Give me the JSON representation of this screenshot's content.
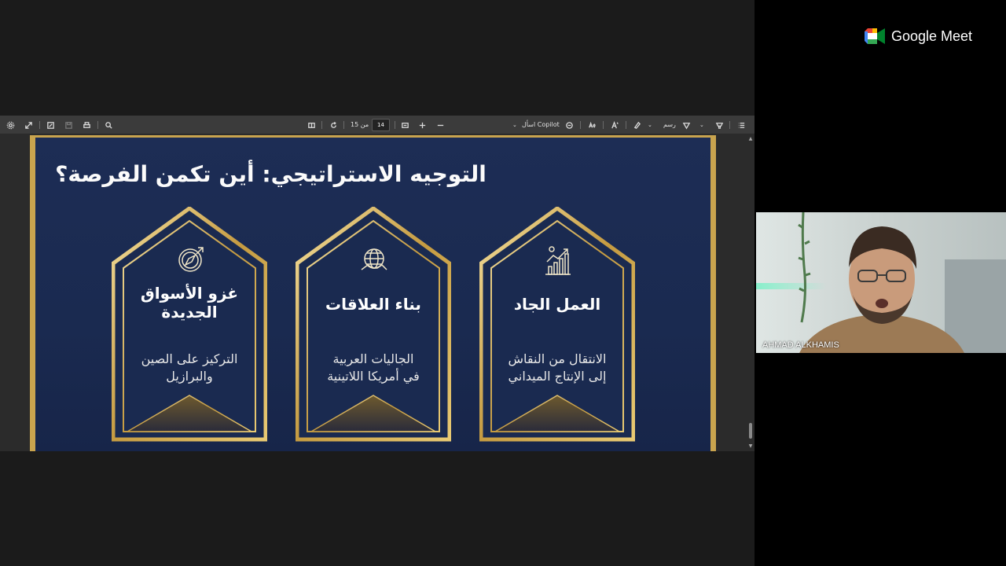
{
  "toolbar": {
    "page_current": "14",
    "page_total_label": "من 15",
    "ask_copilot": "اسأل Copilot",
    "draw_label": "رسم"
  },
  "slide": {
    "title": "التوجيه الاستراتيجي: أين تكمن الفرصة؟",
    "cards": [
      {
        "title": "العمل الجاد",
        "desc_line1": "الانتقال من النقاش",
        "desc_line2": "إلى الإنتاج الميداني",
        "icon": "growth-chart-icon"
      },
      {
        "title": "بناء العلاقات",
        "desc_line1": "الجاليات العربية",
        "desc_line2": "في أمريكا اللاتينية",
        "icon": "globe-handshake-icon"
      },
      {
        "title_line1": "غزو الأسواق",
        "title_line2": "الجديدة",
        "desc_line1": "التركيز على الصين",
        "desc_line2": "والبرازيل",
        "icon": "compass-icon"
      }
    ]
  },
  "meet": {
    "brand": "Google Meet",
    "participant_name": "AHMAD ALKHAMIS"
  },
  "colors": {
    "gold": "#c9a44e",
    "navy": "#1d2d55"
  }
}
